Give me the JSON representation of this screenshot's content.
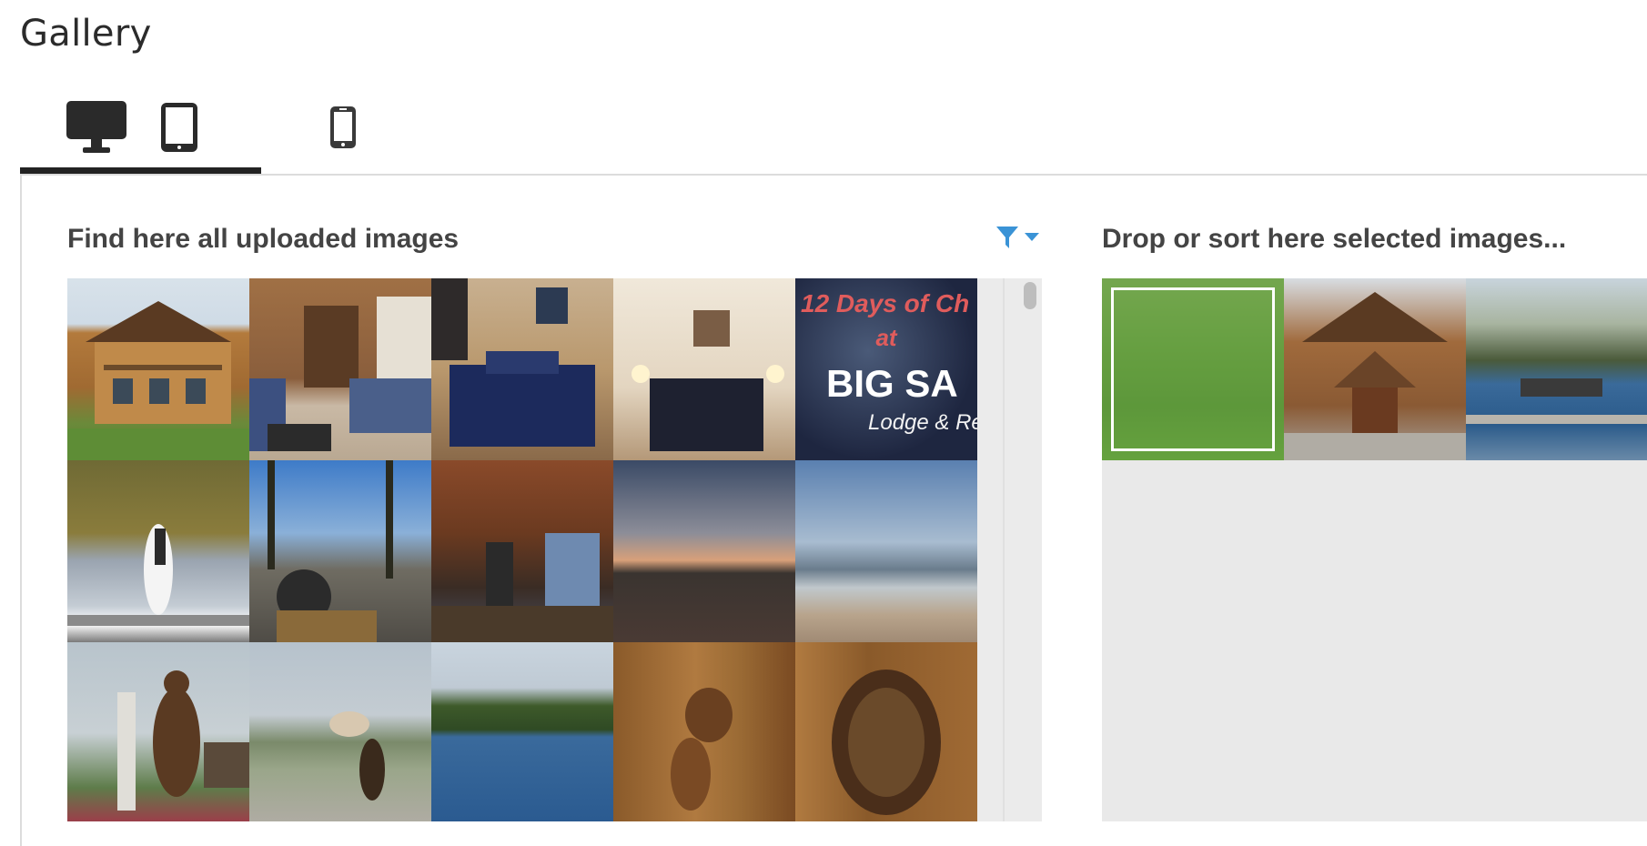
{
  "page": {
    "title": "Gallery"
  },
  "tabs": [
    {
      "name": "Desktop",
      "icon": "desktop-icon",
      "active": true
    },
    {
      "name": "Tablet",
      "icon": "tablet-icon",
      "active": false
    },
    {
      "name": "Mobile",
      "icon": "mobile-icon",
      "active": false
    }
  ],
  "uploaded": {
    "heading": "Find here all uploaded images",
    "filter_icon": "filter-icon",
    "images": [
      "log-lodge-exterior",
      "living-room",
      "bedroom-blue",
      "bedroom-lamps",
      "twelve-days-promo",
      "wedding-couple-dock",
      "motorcycle-forest-road",
      "bar-bartender",
      "sunset-beach",
      "lake-beach",
      "bear-carving-entrance",
      "bear-carving-sign",
      "lake-boats",
      "squirrel-carving",
      "bear-cub-carving"
    ],
    "promo_text": {
      "line1": "12 Days of Ch",
      "line2": "at",
      "line3": "BIG SA",
      "line4": "Lodge & Rese"
    }
  },
  "selected": {
    "heading": "Drop or sort here selected images...",
    "images": [
      "lodge-aerial",
      "lodge-entrance",
      "marina-docks",
      "dining-room"
    ],
    "highlight_color": "#6ebe46"
  }
}
